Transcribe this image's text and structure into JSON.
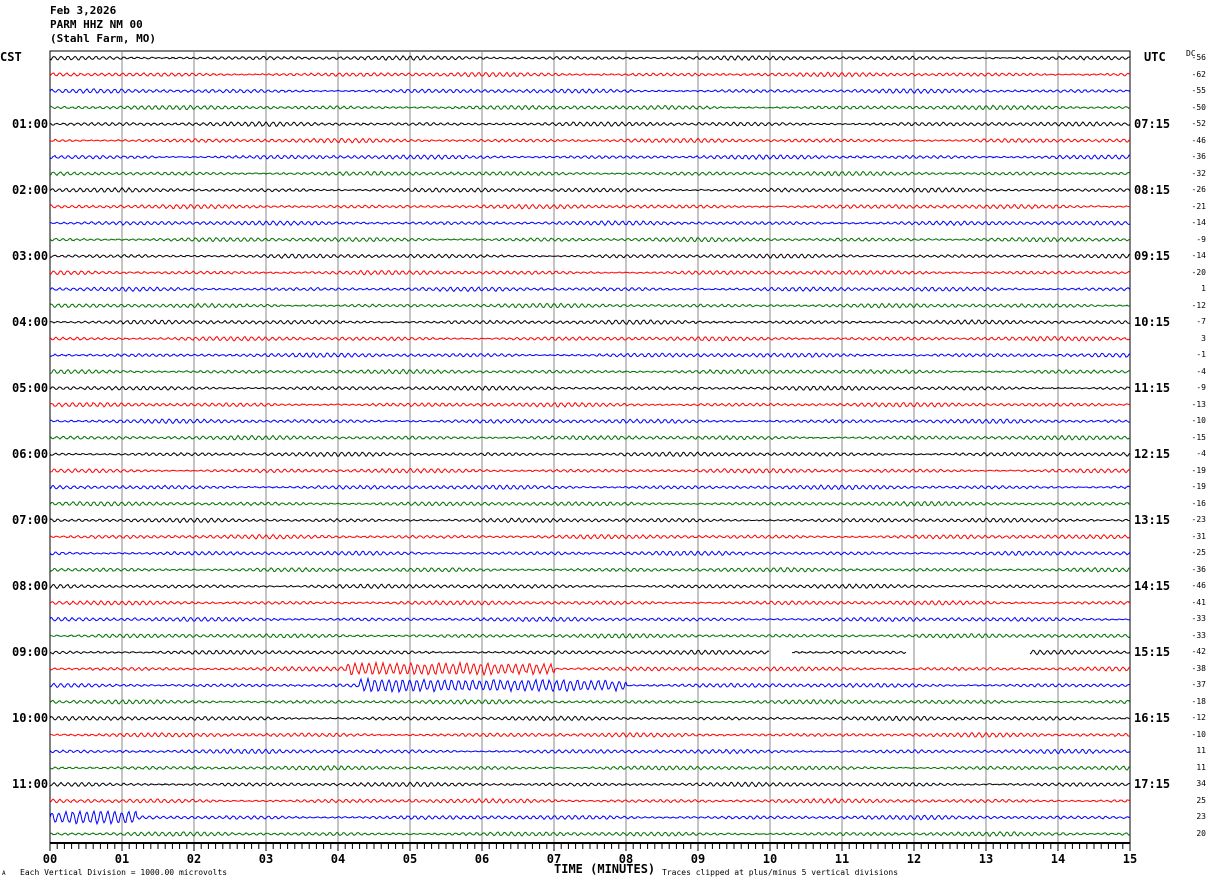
{
  "header": {
    "date": "Feb 3,2026",
    "station": "PARM HHZ NM 00",
    "location": "(Stahl Farm, MO)"
  },
  "left_axis_title": "CST",
  "right_axis_title": "UTC",
  "dc_title": "DC",
  "footer": {
    "scale": "Each Vertical Division = 1000.00 microvolts",
    "xlabel": "TIME (MINUTES)",
    "clip": "Traces clipped at plus/minus 5 vertical divisions",
    "corner": "A"
  },
  "chart_data": {
    "type": "line",
    "title": "",
    "xlabel": "TIME (MINUTES)",
    "xlim": [
      0,
      15
    ],
    "x_ticks": [
      "00",
      "01",
      "02",
      "03",
      "04",
      "05",
      "06",
      "07",
      "08",
      "09",
      "10",
      "11",
      "12",
      "13",
      "14",
      "15"
    ],
    "grid": true,
    "trace_colors": [
      "#000000",
      "#ff0000",
      "#0000ff",
      "#007000"
    ],
    "cst_labels": [
      "01:00",
      "02:00",
      "03:00",
      "04:00",
      "05:00",
      "06:00",
      "07:00",
      "08:00",
      "09:00",
      "10:00",
      "11:00"
    ],
    "utc_labels": [
      "07:15",
      "08:15",
      "09:15",
      "10:15",
      "11:15",
      "12:15",
      "13:15",
      "14:15",
      "15:15",
      "16:15",
      "17:15"
    ],
    "dc_offsets": [
      "-56",
      "-62",
      "-55",
      "-50",
      "-52",
      "-46",
      "-36",
      "-32",
      "-26",
      "-21",
      "-14",
      "-9",
      "-14",
      "-20",
      "1",
      "-12",
      "-7",
      "3",
      "-1",
      "-4",
      "-9",
      "-13",
      "-10",
      "-15",
      "-4",
      "-19",
      "-19",
      "-16",
      "-23",
      "-31",
      "-25",
      "-36",
      "-46",
      "-41",
      "-33",
      "-33",
      "-42",
      "-38",
      "-37",
      "-18",
      "-12",
      "-10",
      "11",
      "11",
      "34",
      "25",
      "23",
      "20"
    ],
    "events": [
      {
        "trace": 37,
        "start_min": 4.1,
        "end_min": 7.0
      },
      {
        "trace": 38,
        "start_min": 4.3,
        "end_min": 8.0
      },
      {
        "trace": 46,
        "start_min": 0.0,
        "end_min": 1.2
      }
    ],
    "gaps": [
      {
        "trace": 36,
        "start_min": 10.0,
        "end_min": 10.3
      },
      {
        "trace": 36,
        "start_min": 11.9,
        "end_min": 13.6
      }
    ]
  }
}
